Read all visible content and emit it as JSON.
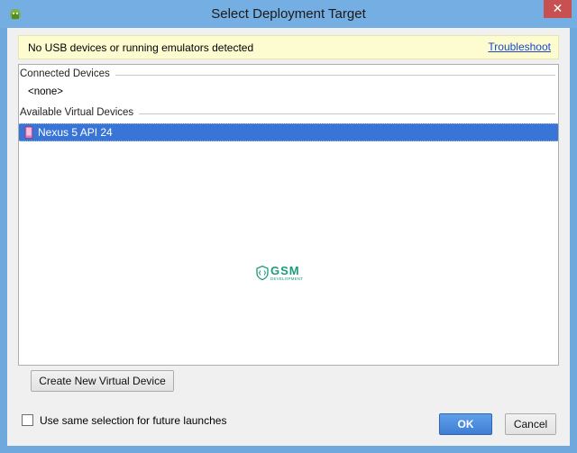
{
  "window": {
    "title": "Select Deployment Target",
    "close_glyph": "✕"
  },
  "notice": {
    "message": "No USB devices or running emulators detected",
    "troubleshoot_link": "Troubleshoot"
  },
  "device_list": {
    "connected_header": "Connected Devices",
    "connected_empty": "<none>",
    "virtual_header": "Available Virtual Devices",
    "virtual_devices": [
      {
        "name": "Nexus 5 API 24",
        "selected": true,
        "icon": "phone-icon"
      }
    ]
  },
  "watermark": {
    "logo_text": "GSM",
    "logo_sub": "DEVELOPMENT"
  },
  "buttons": {
    "create_device": "Create New Virtual Device",
    "ok": "OK",
    "cancel": "Cancel"
  },
  "options": {
    "same_selection_label": "Use same selection for future launches",
    "same_selection_checked": false
  },
  "colors": {
    "selection": "#3875d6",
    "notice_bg": "#fdfcd1",
    "link": "#1a46d2",
    "titlebar": "#74aee2"
  }
}
